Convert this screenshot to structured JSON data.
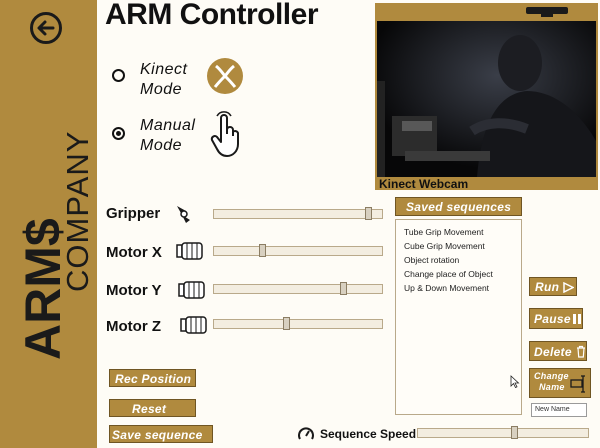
{
  "app": {
    "title": "ARM Controller"
  },
  "brand": {
    "logo_text": "ARM$",
    "logo_sub": "COMPANY",
    "accent_color": "#b08a3e"
  },
  "modes": [
    {
      "label_line1": "Kinect",
      "label_line2": "Mode",
      "selected": false,
      "icon": "xbox-icon"
    },
    {
      "label_line1": "Manual",
      "label_line2": "Mode",
      "selected": true,
      "icon": "hand-pointer-icon"
    }
  ],
  "webcam": {
    "label": "Kinect Webcam"
  },
  "sliders": [
    {
      "label": "Gripper",
      "icon": "gripper-icon",
      "level": 0.93
    },
    {
      "label": "Motor X",
      "icon": "motor-icon",
      "level": 0.28
    },
    {
      "label": "Motor Y",
      "icon": "motor-icon",
      "level": 0.78
    },
    {
      "label": "Motor Z",
      "icon": "motor-icon",
      "level": 0.43
    }
  ],
  "buttons": {
    "rec_position": "Rec Position",
    "reset": "Reset",
    "save_sequence": "Save sequence",
    "run": "Run",
    "pause": "Pause",
    "delete": "Delete",
    "change_name_line1": "Change",
    "change_name_line2": "Name"
  },
  "saved_sequences": {
    "title": "Saved sequences",
    "items": [
      "Tube Grip Movement",
      "Cube Grip Movement",
      "Object rotation",
      "Change place of Object",
      "Up & Down Movement"
    ]
  },
  "new_name": {
    "placeholder": "New Name"
  },
  "sequence_speed": {
    "label": "Sequence Speed",
    "level": 0.57
  }
}
